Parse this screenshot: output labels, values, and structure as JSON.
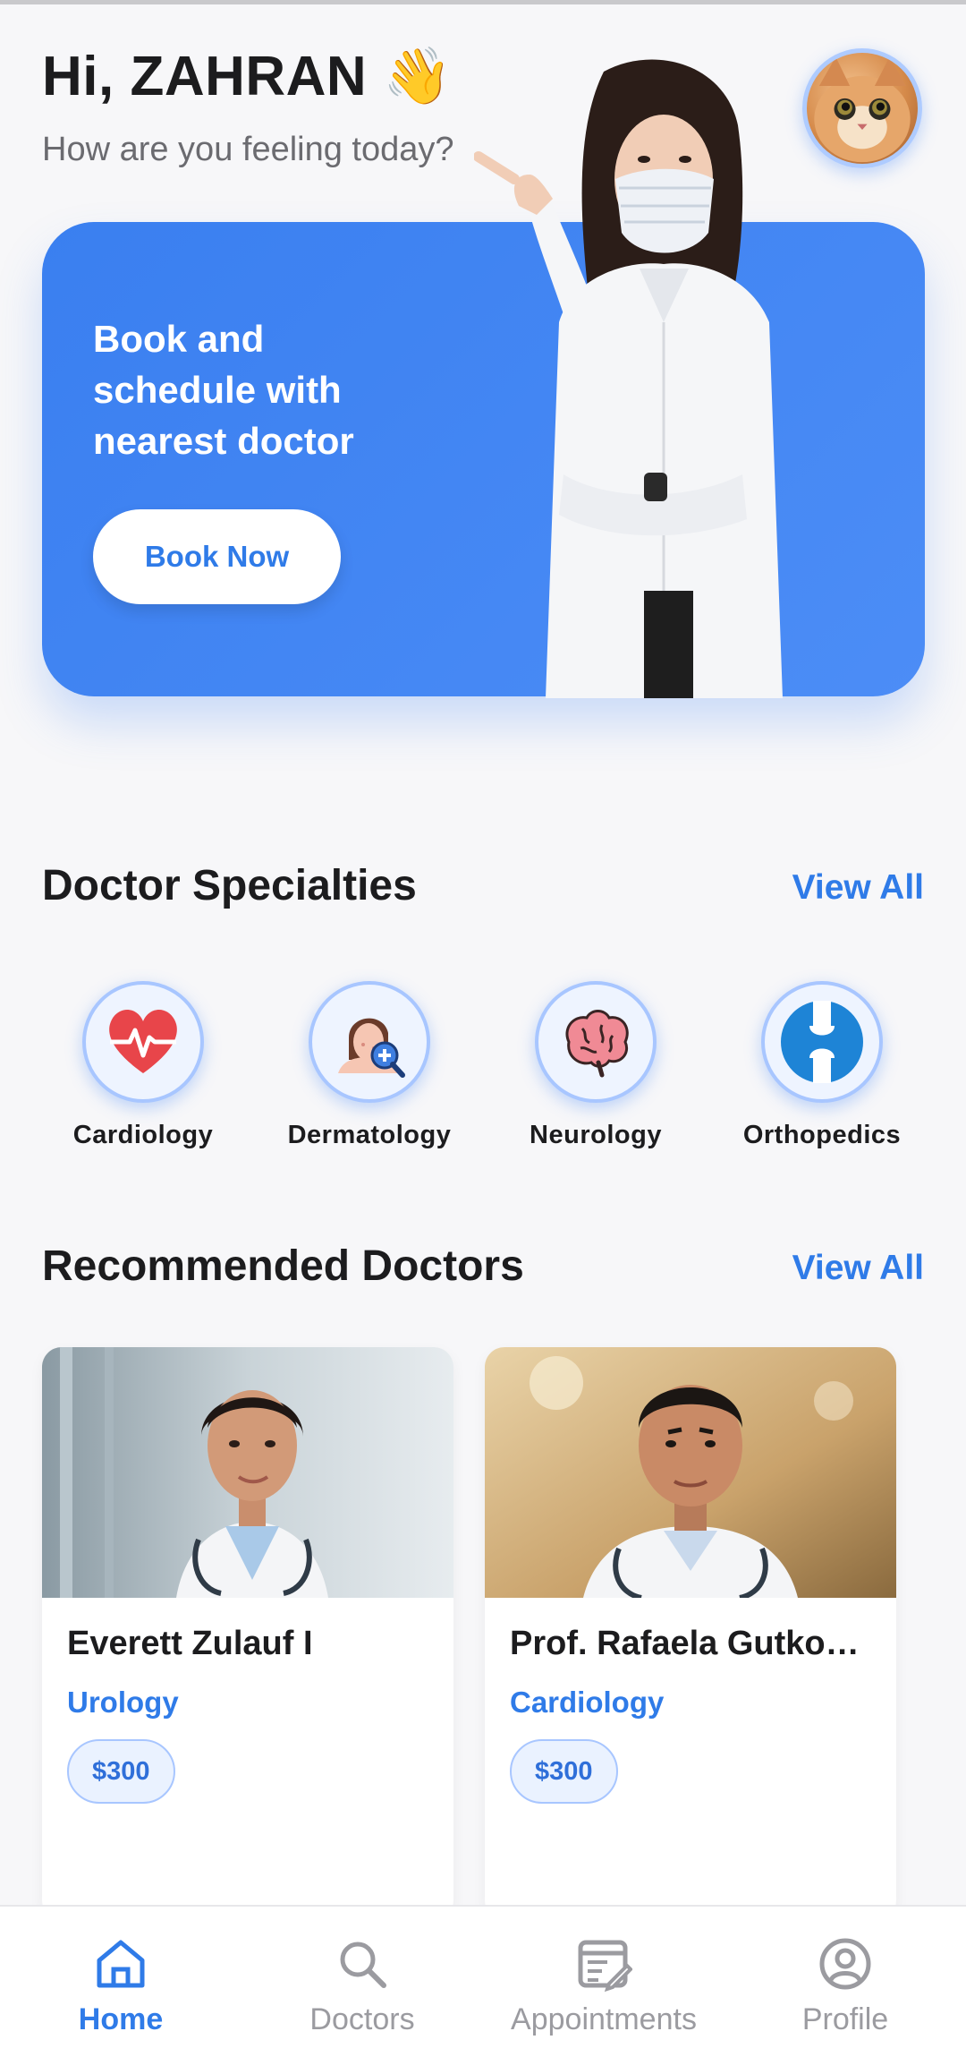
{
  "header": {
    "greeting": "Hi, ZAHRAN",
    "wave_emoji": "👋",
    "subtitle": "How are you feeling today?",
    "avatar_icon": "cat-avatar"
  },
  "banner": {
    "text": "Book and schedule with nearest doctor",
    "button_label": "Book Now",
    "accent_color": "#4a8bf5"
  },
  "specialties": {
    "title": "Doctor Specialties",
    "view_all": "View All",
    "items": [
      {
        "label": "Cardiology",
        "icon": "heart-pulse-icon"
      },
      {
        "label": "Dermatology",
        "icon": "skin-magnify-icon"
      },
      {
        "label": "Neurology",
        "icon": "brain-icon"
      },
      {
        "label": "Orthopedics",
        "icon": "bone-joint-icon"
      }
    ]
  },
  "doctors": {
    "title": "Recommended Doctors",
    "view_all": "View All",
    "items": [
      {
        "name": "Everett Zulauf I",
        "specialty": "Urology",
        "price": "$300"
      },
      {
        "name": "Prof. Rafaela Gutko…",
        "specialty": "Cardiology",
        "price": "$300"
      }
    ]
  },
  "nav": {
    "items": [
      {
        "label": "Home",
        "icon": "home-icon",
        "active": true
      },
      {
        "label": "Doctors",
        "icon": "search-icon",
        "active": false
      },
      {
        "label": "Appointments",
        "icon": "clipboard-edit-icon",
        "active": false
      },
      {
        "label": "Profile",
        "icon": "user-circle-icon",
        "active": false
      }
    ]
  }
}
